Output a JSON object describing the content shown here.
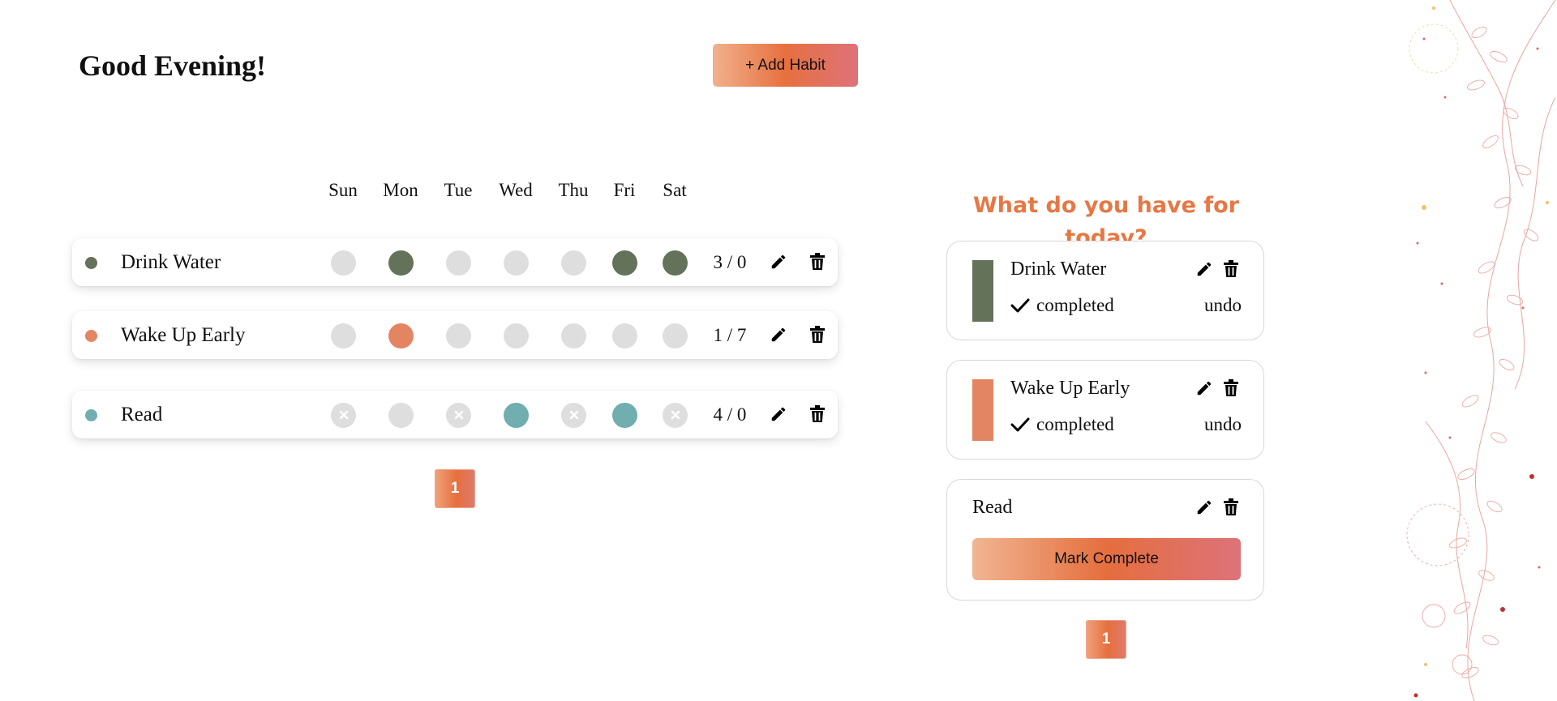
{
  "header": {
    "greeting": "Good Evening!",
    "add_button_label": "+ Add Habit"
  },
  "days": [
    "Sun",
    "Mon",
    "Tue",
    "Wed",
    "Thu",
    "Fri",
    "Sat"
  ],
  "habits": [
    {
      "name": "Drink Water",
      "color": "#637259",
      "count": "3 / 0",
      "week": [
        "empty",
        "done",
        "empty",
        "empty",
        "empty",
        "done",
        "done"
      ]
    },
    {
      "name": "Wake Up Early",
      "color": "#e38563",
      "count": "1 / 7",
      "week": [
        "empty",
        "done",
        "empty",
        "empty",
        "empty",
        "empty",
        "empty"
      ]
    },
    {
      "name": "Read",
      "color": "#70aeaf",
      "count": "4 / 0",
      "week": [
        "skipped",
        "empty",
        "skipped",
        "done",
        "skipped",
        "done",
        "skipped"
      ]
    }
  ],
  "habits_pagination": {
    "pages": [
      "1"
    ],
    "current": "1"
  },
  "today": {
    "title": "What do you have for today?",
    "cards": [
      {
        "name": "Drink Water",
        "color": "#637259",
        "completed": true,
        "status": "completed",
        "undo_label": "undo"
      },
      {
        "name": "Wake Up Early",
        "color": "#e38563",
        "completed": true,
        "status": "completed",
        "undo_label": "undo"
      },
      {
        "name": "Read",
        "color": "#70aeaf",
        "completed": false,
        "action_label": "Mark Complete"
      }
    ],
    "pagination": {
      "pages": [
        "1"
      ],
      "current": "1"
    }
  },
  "icons": {
    "edit": "pencil-icon",
    "delete": "trash-icon",
    "check": "check-icon",
    "skip": "x-icon"
  }
}
